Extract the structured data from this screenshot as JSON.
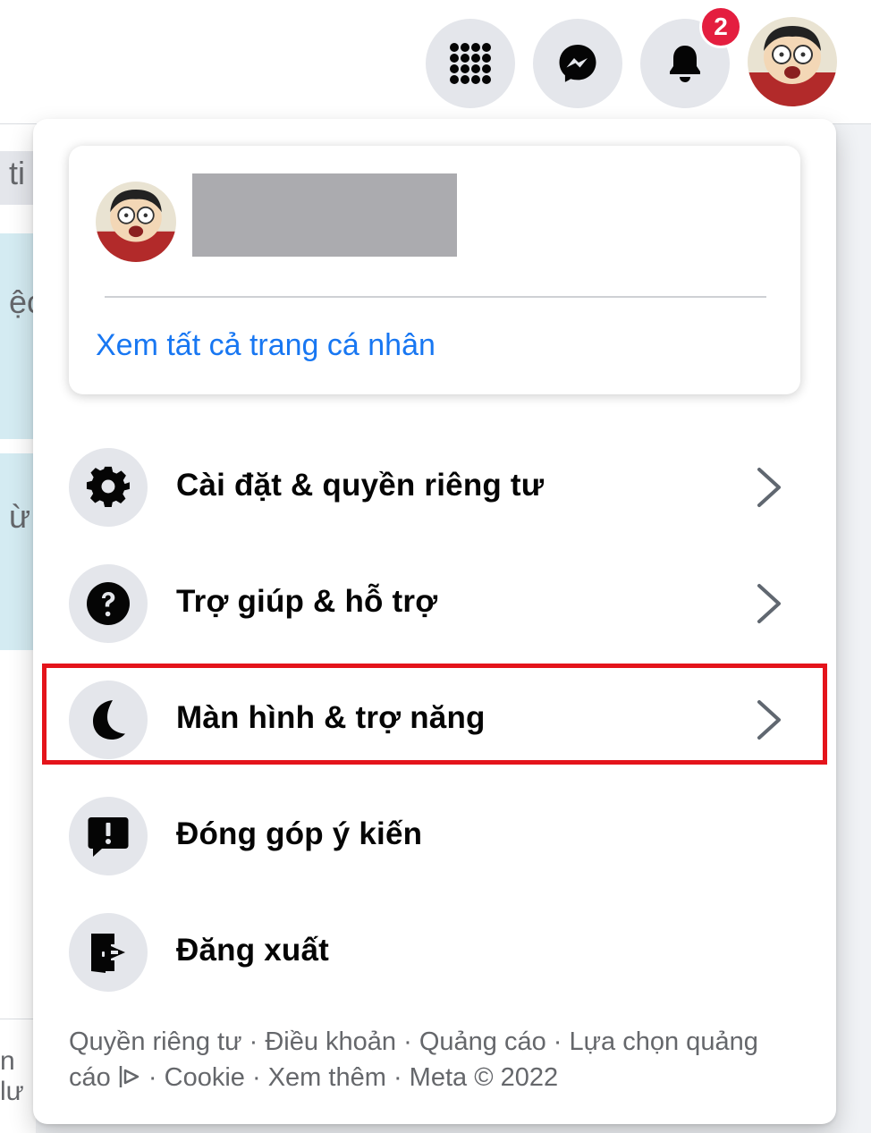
{
  "topbar": {
    "notification_count": "2",
    "icons": [
      "menu-grid-icon",
      "messenger-icon",
      "bell-icon",
      "profile-avatar"
    ]
  },
  "background": {
    "fragment_1": "ti",
    "fragment_2": "ệc",
    "fragment_3": "ừ",
    "fragment_4": "n lư"
  },
  "profile_card": {
    "see_all_profiles": "Xem tất cả trang cá nhân"
  },
  "menu": {
    "items": [
      {
        "label": "Cài đặt & quyền riêng tư",
        "icon": "gear-icon",
        "has_chevron": true
      },
      {
        "label": "Trợ giúp & hỗ trợ",
        "icon": "help-icon",
        "has_chevron": true
      },
      {
        "label": "Màn hình & trợ năng",
        "icon": "moon-icon",
        "has_chevron": true,
        "highlighted": true
      },
      {
        "label": "Đóng góp ý kiến",
        "icon": "feedback-icon",
        "has_chevron": false
      },
      {
        "label": "Đăng xuất",
        "icon": "logout-icon",
        "has_chevron": false
      }
    ]
  },
  "footer": {
    "privacy": "Quyền riêng tư",
    "terms": "Điều khoản",
    "ads": "Quảng cáo",
    "ad_choices": "Lựa chọn quảng cáo",
    "cookie": "Cookie",
    "more": "Xem thêm",
    "copyright": "Meta © 2022",
    "separator": "·"
  },
  "colors": {
    "link_blue": "#1877f2",
    "badge_red": "#e41e3f",
    "highlight_red": "#e4141b",
    "icon_bg": "#e4e6eb"
  }
}
